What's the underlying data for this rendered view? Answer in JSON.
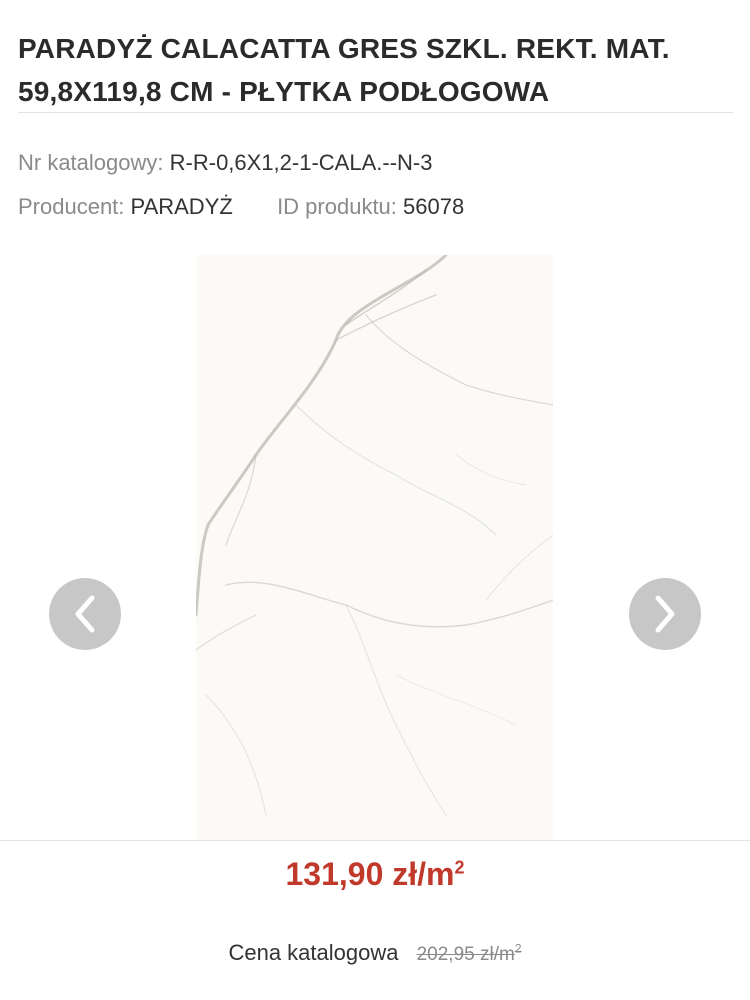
{
  "product": {
    "title": "PARADYŻ CALACATTA GRES SZKL. REKT. MAT. 59,8X119,8 CM - PŁYTKA PODŁOGOWA",
    "catalog_number_label": "Nr katalogowy:",
    "catalog_number": "R-R-0,6X1,2-1-CALA.--N-3",
    "producer_label": "Producent:",
    "producer": "PARADYŻ",
    "product_id_label": "ID produktu:",
    "product_id": "56078"
  },
  "gallery": {
    "prev_icon": "chevron-left-icon",
    "next_icon": "chevron-right-icon"
  },
  "pricing": {
    "price": "131,90 zł/m",
    "price_sup": "2",
    "catalog_label": "Cena katalogowa",
    "catalog_price": "202,95 zł/m",
    "catalog_price_sup": "2"
  },
  "colors": {
    "price": "#c0392b",
    "nav_button": "#c7c7c7",
    "tile": "#fbfaf6",
    "vein": "#b9b8b0"
  }
}
